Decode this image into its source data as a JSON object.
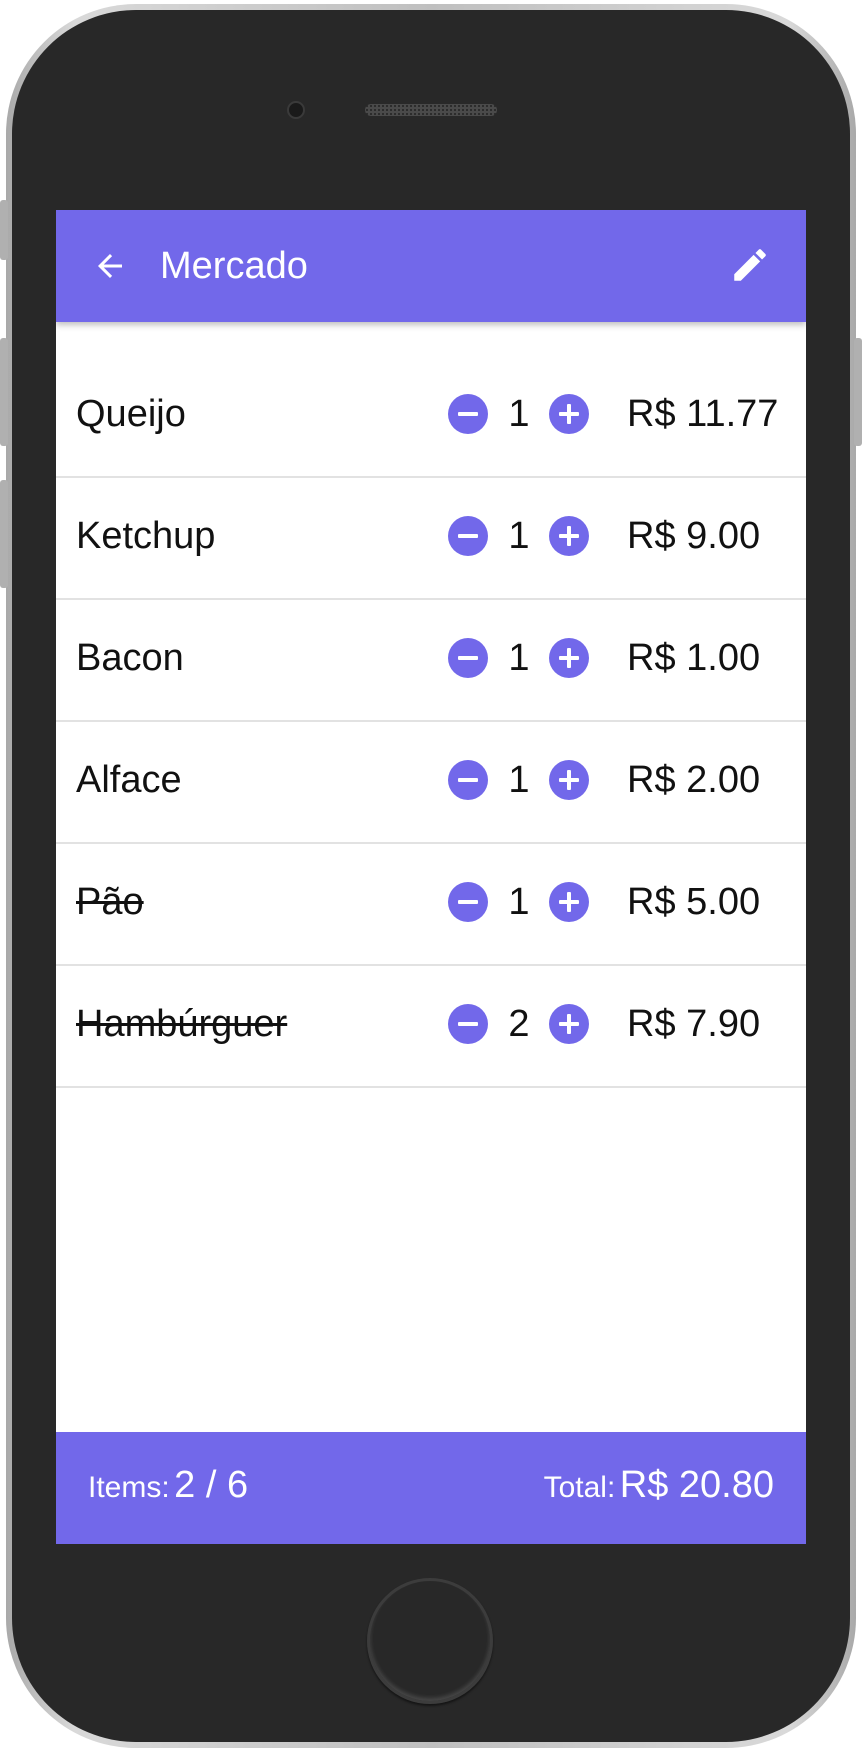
{
  "theme": {
    "accent": "#7268ea",
    "text": "#111111",
    "divider": "#e2e2e2"
  },
  "appbar": {
    "title": "Mercado",
    "back_icon": "arrow-left-icon",
    "edit_icon": "pencil-icon"
  },
  "items": [
    {
      "name": "Queijo",
      "qty": "1",
      "price": "R$ 11.77",
      "checked": false
    },
    {
      "name": "Ketchup",
      "qty": "1",
      "price": "R$ 9.00",
      "checked": false
    },
    {
      "name": "Bacon",
      "qty": "1",
      "price": "R$ 1.00",
      "checked": false
    },
    {
      "name": "Alface",
      "qty": "1",
      "price": "R$ 2.00",
      "checked": false
    },
    {
      "name": "Pão",
      "qty": "1",
      "price": "R$ 5.00",
      "checked": true
    },
    {
      "name": "Hambúrguer",
      "qty": "2",
      "price": "R$ 7.90",
      "checked": true
    }
  ],
  "footer": {
    "items_label": "Items:",
    "items_value": "2 / 6",
    "total_label": "Total:",
    "total_value": "R$ 20.80"
  }
}
